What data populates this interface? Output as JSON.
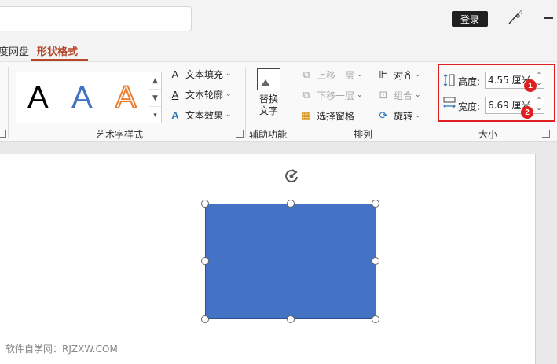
{
  "titlebar": {
    "login_label": "登录"
  },
  "tabs": [
    {
      "label": "度网盘"
    },
    {
      "label": "形状格式",
      "active": true
    }
  ],
  "wordart_group": {
    "label": "艺术字样式",
    "samples": [
      "A",
      "A",
      "A"
    ],
    "commands": [
      {
        "label": "文本填充"
      },
      {
        "label": "文本轮廓"
      },
      {
        "label": "文本效果"
      }
    ]
  },
  "accessibility_group": {
    "label": "辅助功能",
    "alt_text_line1": "替换",
    "alt_text_line2": "文字"
  },
  "arrange_group": {
    "label": "排列",
    "bring_forward": "上移一层",
    "send_backward": "下移一层",
    "selection_pane": "选择窗格",
    "align": "对齐",
    "group": "组合",
    "rotate": "旋转"
  },
  "size_group": {
    "label": "大小",
    "height_label": "高度:",
    "height_value": "4.55 厘米",
    "width_label": "宽度:",
    "width_value": "6.69 厘米",
    "marker_1": "1",
    "marker_2": "2"
  },
  "watermark": "软件自学网：RJZXW.COM",
  "colors": {
    "accent": "#b7472a",
    "shape_fill": "#4472c4",
    "highlight": "#e02020"
  }
}
